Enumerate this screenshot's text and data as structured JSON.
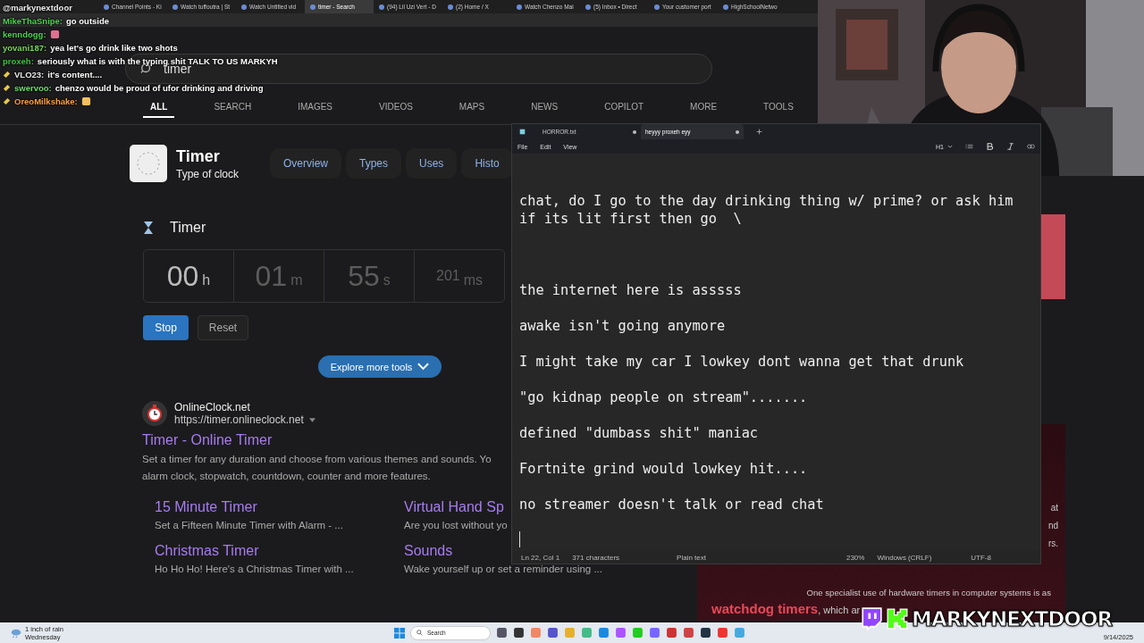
{
  "browser": {
    "tabs": [
      {
        "label": "Channel Points - Ki",
        "selected": false
      },
      {
        "label": "Watch tuffoutra | St",
        "selected": false
      },
      {
        "label": "Watch Untitled vid",
        "selected": false
      },
      {
        "label": "timer - Search",
        "selected": true
      },
      {
        "label": "(94) Lil Uzi Vert - D",
        "selected": false
      },
      {
        "label": "(2) Home / X",
        "selected": false
      },
      {
        "label": "Watch Chenzo Mai",
        "selected": false
      },
      {
        "label": "(5) Inbox • Direct",
        "selected": false
      },
      {
        "label": "Your customer port",
        "selected": false
      },
      {
        "label": "HighSchoolNetwo",
        "selected": false
      }
    ],
    "search_value": "timer",
    "nav": [
      {
        "label": "ALL",
        "selected": true
      },
      {
        "label": "SEARCH",
        "selected": false
      },
      {
        "label": "IMAGES",
        "selected": false
      },
      {
        "label": "VIDEOS",
        "selected": false
      },
      {
        "label": "MAPS",
        "selected": false
      },
      {
        "label": "NEWS",
        "selected": false
      },
      {
        "label": "COPILOT",
        "selected": false
      },
      {
        "label": "MORE",
        "selected": false
      },
      {
        "label": "TOOLS",
        "selected": false
      }
    ],
    "entity": {
      "title": "Timer",
      "subtitle": "Type of clock",
      "tabs": [
        "Overview",
        "Types",
        "Uses",
        "Histo"
      ]
    },
    "timer": {
      "title": "Timer",
      "units": [
        {
          "value": "00",
          "unit": "h",
          "lit": true
        },
        {
          "value": "01",
          "unit": "m",
          "lit": false
        },
        {
          "value": "55",
          "unit": "s",
          "lit": false
        },
        {
          "value": "201",
          "unit": "ms",
          "lit": false
        }
      ],
      "buttons": [
        {
          "label": "Stop",
          "kind": "primary"
        },
        {
          "label": "Reset",
          "kind": "secondary"
        }
      ]
    },
    "explore": "Explore more tools",
    "result": {
      "site": "OnlineClock.net",
      "url": "https://timer.onlineclock.net",
      "title": "Timer - Online Timer",
      "snippet": [
        "Set a timer for any duration and choose from various themes and sounds. Yo",
        "alarm clock, stopwatch, countdown, counter and more features."
      ],
      "links": [
        {
          "title": "15 Minute Timer",
          "desc": "Set a Fifteen Minute Timer with Alarm - ..."
        },
        {
          "title": "Virtual Hand Sp",
          "desc": "Are you lost without yo"
        },
        {
          "title": "Christmas Timer",
          "desc": "Ho Ho Ho! Here's a Christmas Timer with ..."
        },
        {
          "title": "Sounds",
          "desc": "Wake yourself up or set a reminder using ..."
        }
      ]
    },
    "side_fragments": [
      "at",
      "nd",
      "rs."
    ],
    "side_text": "One specialist use of hardware timers in computer systems is as",
    "side_link": "watchdog timers",
    "side_tail": ", which ar"
  },
  "chat": {
    "channel": "@markynextdoor",
    "messages": [
      {
        "user": "MikeThaSnipe:",
        "color": "#4fd34f",
        "text": "go outside",
        "badge": false,
        "kind": "text"
      },
      {
        "user": "kenndogg:",
        "color": "#4fd34f",
        "badge": false,
        "kind": "emote"
      },
      {
        "user": "yovani187:",
        "color": "#7fd85f",
        "text": "yea let's go drink like two shots",
        "badge": false,
        "kind": "text"
      },
      {
        "user": "proxeh:",
        "color": "#3fc03f",
        "text": "seriously what is with the typing shit TALK TO US MARKYH",
        "badge": false,
        "kind": "text"
      },
      {
        "user": "VLO23:",
        "color": "#e8e8e8",
        "text": "it's content....",
        "badge": true,
        "kind": "text"
      },
      {
        "user": "swervoo:",
        "color": "#6fdc6f",
        "text": "chenzo would be proud of ufor drinking and driving",
        "badge": true,
        "kind": "text"
      },
      {
        "user": "OreoMilkshake:",
        "color": "#ff9f3f",
        "badge": true,
        "kind": "emote"
      }
    ]
  },
  "notepad": {
    "tabs": [
      {
        "label": "HORROR.txt",
        "selected": false,
        "unsaved": true
      },
      {
        "label": "heyyy proxeh eyy",
        "selected": true,
        "unsaved": true
      }
    ],
    "menu": [
      "File",
      "Edit",
      "View"
    ],
    "heading": "H1",
    "paragraphs": [
      "chat, do I go to the day drinking thing w/ prime? or ask him if its lit first then go  \\",
      "the internet here is asssss",
      "awake isn't going anymore",
      "I might take my car I lowkey dont wanna get that drunk",
      "\"go kidnap people on stream\".......",
      "defined \"dumbass shit\" maniac",
      "Fortnite grind would lowkey hit....",
      "no streamer doesn't talk or read chat"
    ],
    "status": {
      "position": "Ln 22, Col 1",
      "count": "371 characters",
      "format": "Plain text",
      "zoom": "230%",
      "line_ending": "Windows (CRLF)",
      "encoding": "UTF-8"
    }
  },
  "taskbar": {
    "weather": "1 inch of rain",
    "day": "Wednesday",
    "search": "Search",
    "date": "9/14/2025"
  },
  "overlay": {
    "name": "MARKYNEXTDOOR"
  }
}
